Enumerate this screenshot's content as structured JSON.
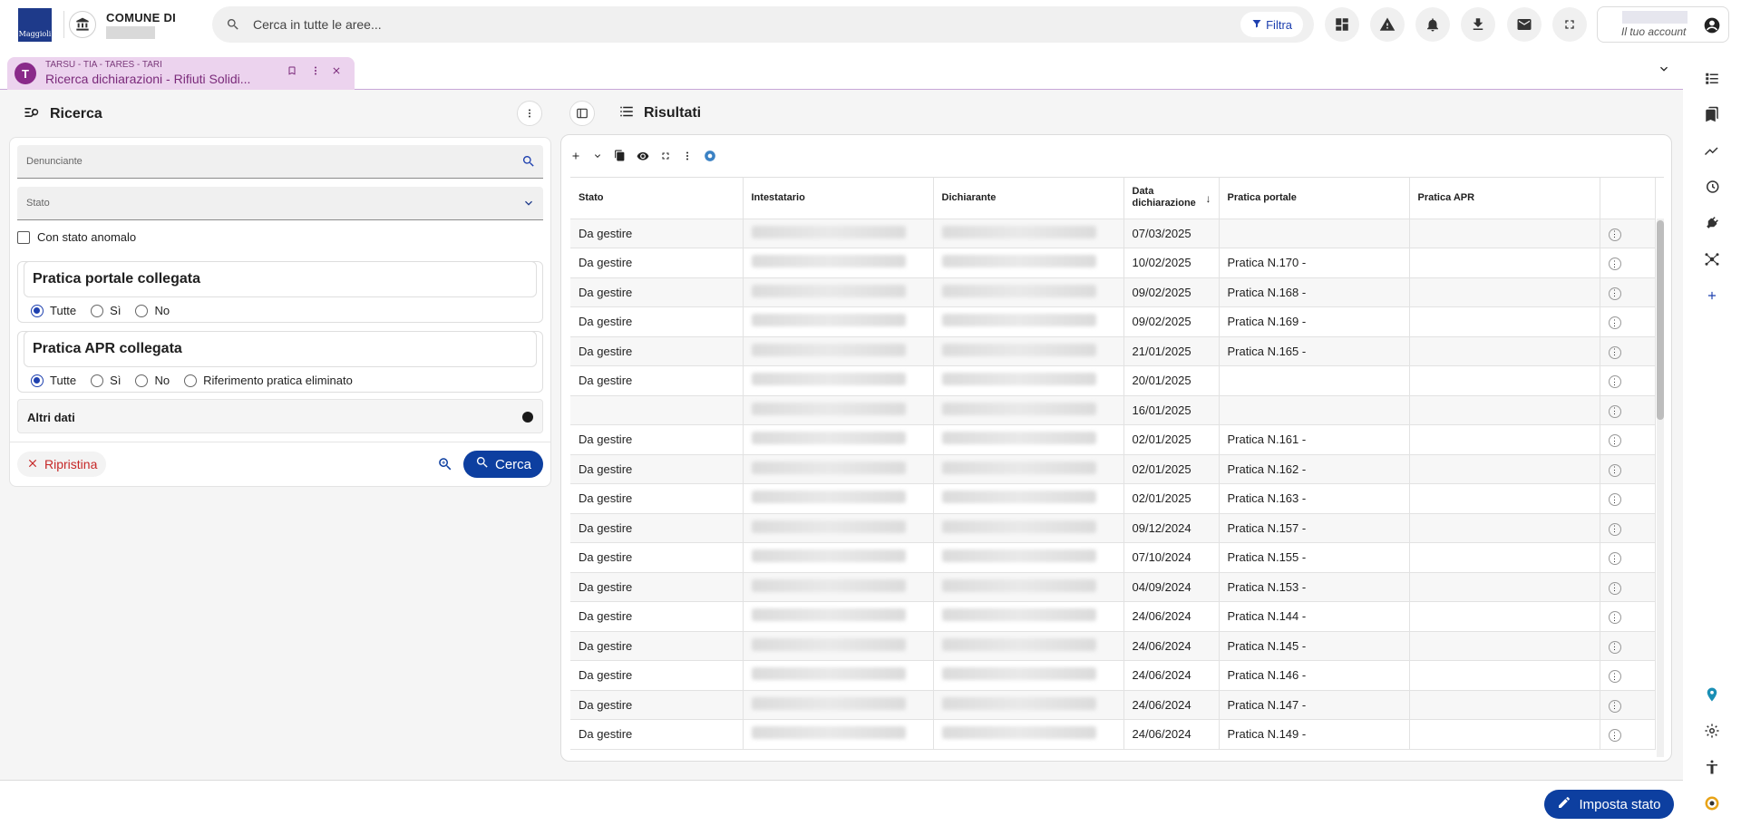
{
  "header": {
    "logo_text": "Maggioli",
    "comune_title": "COMUNE DI",
    "search_placeholder": "Cerca in tutte le aree...",
    "filter_label": "Filtra",
    "account_label": "Il tuo account"
  },
  "tab": {
    "category": "TARSU - TIA - TARES - TARI",
    "title": "Ricerca dichiarazioni - Rifiuti Solidi..."
  },
  "search_panel": {
    "title": "Ricerca",
    "denunciante_label": "Denunciante",
    "stato_label": "Stato",
    "anomalo_label": "Con stato anomalo",
    "portale_group_title": "Pratica portale collegata",
    "portale_options": [
      "Tutte",
      "Sì",
      "No"
    ],
    "apr_group_title": "Pratica APR collegata",
    "apr_options": [
      "Tutte",
      "Sì",
      "No",
      "Riferimento pratica eliminato"
    ],
    "altri_dati_label": "Altri dati",
    "ripristina_label": "Ripristina",
    "cerca_label": "Cerca"
  },
  "results": {
    "title": "Risultati",
    "columns": [
      "Stato",
      "Intestatario",
      "Dichiarante",
      "Data dichiarazione",
      "Pratica portale",
      "Pratica APR"
    ],
    "rows": [
      {
        "stato": "Da gestire",
        "data": "07/03/2025",
        "portale": ""
      },
      {
        "stato": "Da gestire",
        "data": "10/02/2025",
        "portale": "Pratica N.170 -"
      },
      {
        "stato": "Da gestire",
        "data": "09/02/2025",
        "portale": "Pratica N.168 -"
      },
      {
        "stato": "Da gestire",
        "data": "09/02/2025",
        "portale": "Pratica N.169 -"
      },
      {
        "stato": "Da gestire",
        "data": "21/01/2025",
        "portale": "Pratica N.165 -"
      },
      {
        "stato": "Da gestire",
        "data": "20/01/2025",
        "portale": ""
      },
      {
        "stato": "",
        "data": "16/01/2025",
        "portale": ""
      },
      {
        "stato": "Da gestire",
        "data": "02/01/2025",
        "portale": "Pratica N.161 -"
      },
      {
        "stato": "Da gestire",
        "data": "02/01/2025",
        "portale": "Pratica N.162 -"
      },
      {
        "stato": "Da gestire",
        "data": "02/01/2025",
        "portale": "Pratica N.163 -"
      },
      {
        "stato": "Da gestire",
        "data": "09/12/2024",
        "portale": "Pratica N.157 -"
      },
      {
        "stato": "Da gestire",
        "data": "07/10/2024",
        "portale": "Pratica N.155 -"
      },
      {
        "stato": "Da gestire",
        "data": "04/09/2024",
        "portale": "Pratica N.153 -"
      },
      {
        "stato": "Da gestire",
        "data": "24/06/2024",
        "portale": "Pratica N.144 -"
      },
      {
        "stato": "Da gestire",
        "data": "24/06/2024",
        "portale": "Pratica N.145 -"
      },
      {
        "stato": "Da gestire",
        "data": "24/06/2024",
        "portale": "Pratica N.146 -"
      },
      {
        "stato": "Da gestire",
        "data": "24/06/2024",
        "portale": "Pratica N.147 -"
      },
      {
        "stato": "Da gestire",
        "data": "24/06/2024",
        "portale": "Pratica N.149 -"
      }
    ]
  },
  "footer": {
    "imposta_label": "Imposta stato"
  },
  "colors": {
    "primary": "#0d3fa0",
    "tab_bg": "#ecd3ee",
    "tab_text": "#7a2a7a",
    "danger": "#c62828"
  }
}
